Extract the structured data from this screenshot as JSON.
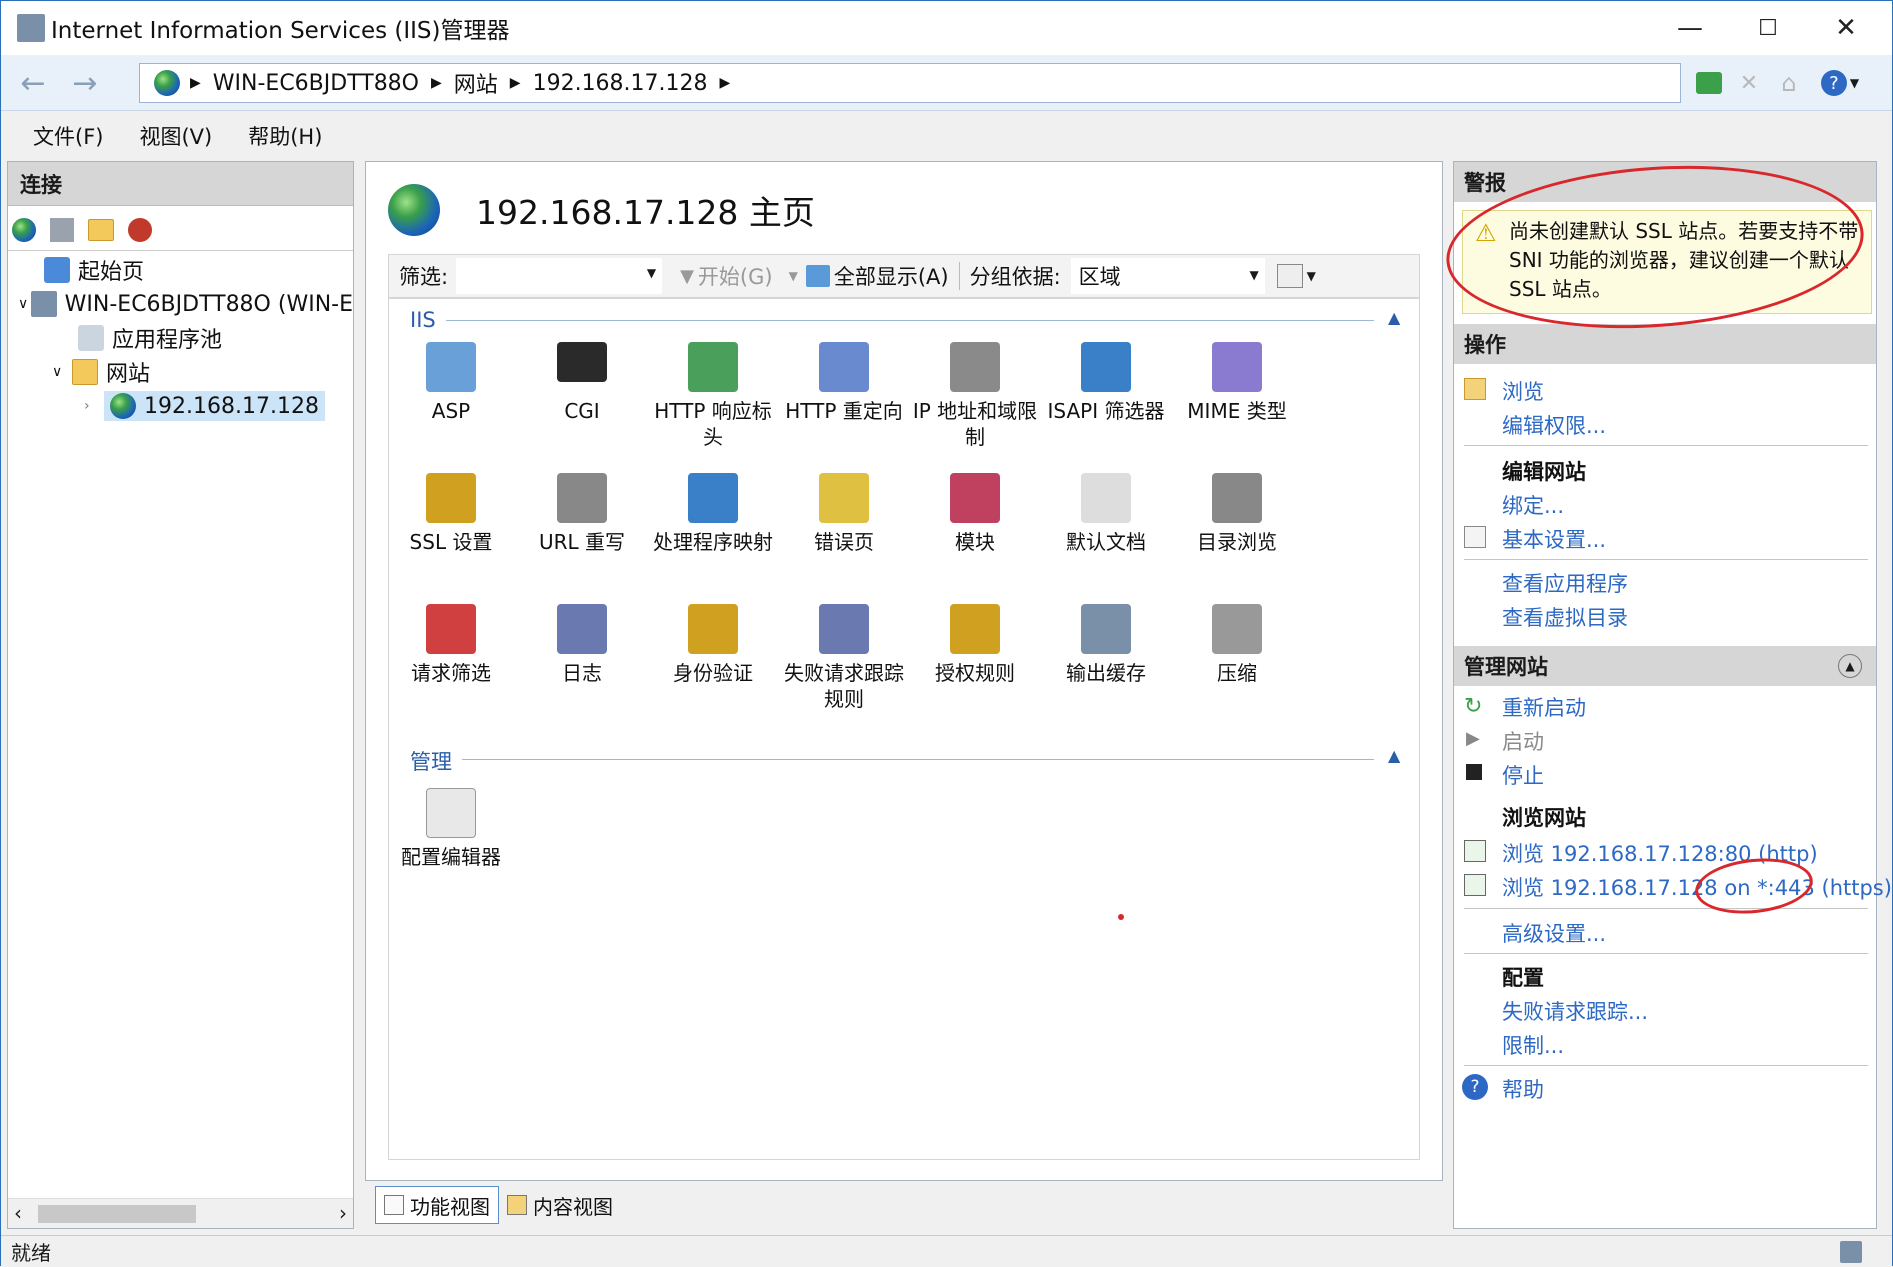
{
  "window": {
    "title": "Internet Information Services (IIS)管理器",
    "controls": {
      "minimize": "—",
      "maximize": "☐",
      "close": "✕"
    }
  },
  "address": {
    "crumbs": [
      "WIN-EC6BJDTT88O",
      "网站",
      "192.168.17.128"
    ]
  },
  "menu": [
    "文件(F)",
    "视图(V)",
    "帮助(H)"
  ],
  "connections": {
    "header": "连接",
    "tree": [
      {
        "label": "起始页"
      },
      {
        "label": "WIN-EC6BJDTT88O (WIN-E"
      },
      {
        "label": "应用程序池"
      },
      {
        "label": "网站"
      },
      {
        "label": "192.168.17.128"
      }
    ]
  },
  "main": {
    "title": "192.168.17.128 主页",
    "filter": {
      "label": "筛选:",
      "start": "开始(G)",
      "show_all": "全部显示(A)",
      "group_by_label": "分组依据:",
      "group_by_value": "区域"
    },
    "groups": [
      {
        "name": "IIS",
        "features": [
          {
            "label": "ASP",
            "icon": "asp-icon"
          },
          {
            "label": "CGI",
            "icon": "cgi-icon"
          },
          {
            "label": "HTTP 响应标头",
            "icon": "http-headers-icon"
          },
          {
            "label": "HTTP 重定向",
            "icon": "http-redirect-icon"
          },
          {
            "label": "IP 地址和域限制",
            "icon": "ip-restrictions-icon"
          },
          {
            "label": "ISAPI 筛选器",
            "icon": "isapi-filters-icon"
          },
          {
            "label": "MIME 类型",
            "icon": "mime-types-icon"
          },
          {
            "label": "SSL 设置",
            "icon": "ssl-lock-icon"
          },
          {
            "label": "URL 重写",
            "icon": "url-rewrite-icon"
          },
          {
            "label": "处理程序映射",
            "icon": "handler-mappings-icon"
          },
          {
            "label": "错误页",
            "icon": "error-pages-icon"
          },
          {
            "label": "模块",
            "icon": "modules-icon"
          },
          {
            "label": "默认文档",
            "icon": "default-document-icon"
          },
          {
            "label": "目录浏览",
            "icon": "directory-browsing-icon"
          },
          {
            "label": "请求筛选",
            "icon": "request-filtering-icon"
          },
          {
            "label": "日志",
            "icon": "logging-icon"
          },
          {
            "label": "身份验证",
            "icon": "authentication-icon"
          },
          {
            "label": "失败请求跟踪规则",
            "icon": "failed-request-tracing-icon"
          },
          {
            "label": "授权规则",
            "icon": "authorization-rules-icon"
          },
          {
            "label": "输出缓存",
            "icon": "output-caching-icon"
          },
          {
            "label": "压缩",
            "icon": "compression-icon"
          }
        ]
      },
      {
        "name": "管理",
        "features": [
          {
            "label": "配置编辑器",
            "icon": "configuration-editor-icon"
          }
        ]
      }
    ],
    "view_tabs": [
      "功能视图",
      "内容视图"
    ]
  },
  "actions": {
    "alerts_header": "警报",
    "alert_text": "尚未创建默认 SSL 站点。若要支持不带 SNI 功能的浏览器，建议创建一个默认 SSL 站点。",
    "actions_header": "操作",
    "browse": "浏览",
    "edit_permissions": "编辑权限...",
    "edit_site": "编辑网站",
    "bindings": "绑定...",
    "basic_settings": "基本设置...",
    "view_apps": "查看应用程序",
    "view_vdirs": "查看虚拟目录",
    "manage_site": "管理网站",
    "restart": "重新启动",
    "start": "启动",
    "stop": "停止",
    "browse_site": "浏览网站",
    "browse_http": "浏览 192.168.17.128:80 (http)",
    "browse_https": "浏览 192.168.17.128 on *:443 (https)",
    "advanced_settings": "高级设置...",
    "configure": "配置",
    "failed_request_tracing": "失败请求跟踪...",
    "limits": "限制...",
    "help": "帮助"
  },
  "status": {
    "text": "就绪"
  },
  "colors": {
    "link": "#2d69c4",
    "annotation": "#d8282c",
    "group_header": "#2a5ea8"
  }
}
